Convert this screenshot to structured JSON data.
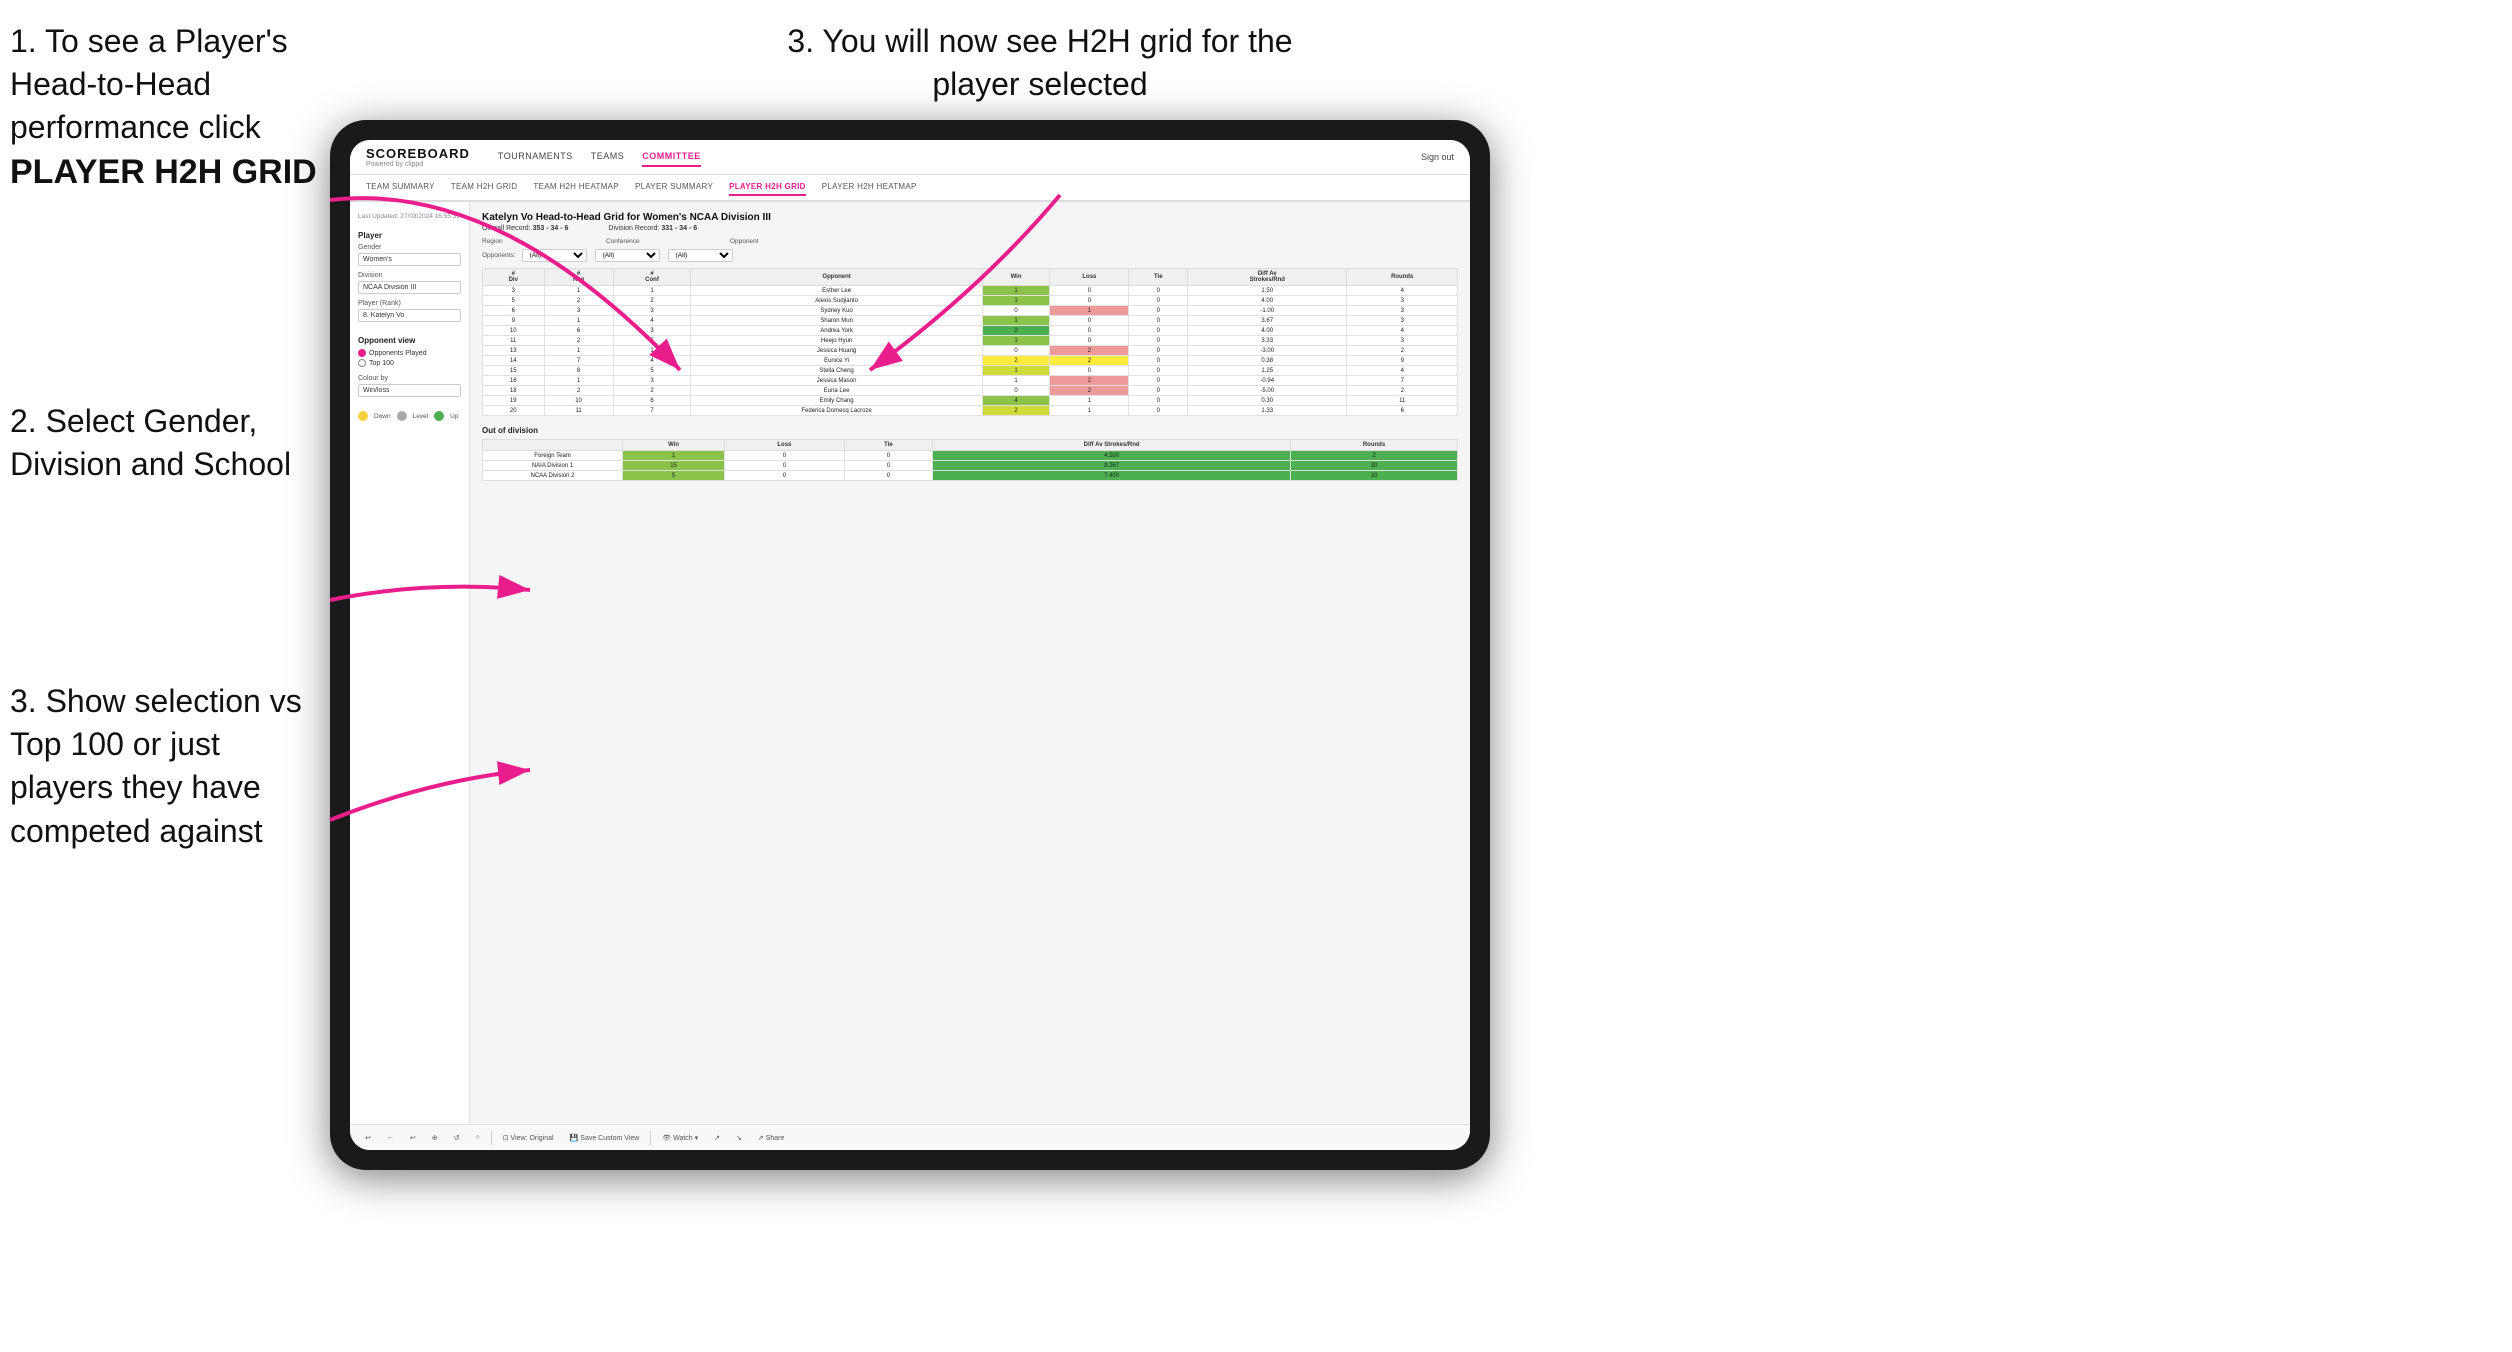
{
  "instructions": {
    "step1_title": "1. To see a Player's Head-to-Head performance click",
    "step1_bold": "PLAYER H2H GRID",
    "step2": "2. Select Gender, Division and School",
    "step3_left": "3. Show selection vs Top 100 or just players they have competed against",
    "step3_right": "3. You will now see H2H grid for the player selected"
  },
  "header": {
    "logo": "SCOREBOARD",
    "logo_sub": "Powered by clippd",
    "nav": [
      "TOURNAMENTS",
      "TEAMS",
      "COMMITTEE"
    ],
    "active_nav": "COMMITTEE",
    "sign_out": "Sign out",
    "sub_nav": [
      "TEAM SUMMARY",
      "TEAM H2H GRID",
      "TEAM H2H HEATMAP",
      "PLAYER SUMMARY",
      "PLAYER H2H GRID",
      "PLAYER H2H HEATMAP"
    ],
    "active_sub": "PLAYER H2H GRID"
  },
  "sidebar": {
    "timestamp": "Last Updated: 27/03/2024\n16:55:39",
    "player_section": "Player",
    "gender_label": "Gender",
    "gender_value": "Women's",
    "division_label": "Division",
    "division_value": "NCAA Division III",
    "player_rank_label": "Player (Rank)",
    "player_rank_value": "8. Katelyn Vo",
    "opponent_view_label": "Opponent view",
    "radio1": "Opponents Played",
    "radio2": "Top 100",
    "colour_label": "Colour by",
    "colour_value": "Win/loss",
    "legend_down": "Down",
    "legend_level": "Level",
    "legend_up": "Up"
  },
  "grid": {
    "title": "Katelyn Vo Head-to-Head Grid for Women's NCAA Division III",
    "overall_record_label": "Overall Record:",
    "overall_record": "353 - 34 - 6",
    "division_record_label": "Division Record:",
    "division_record": "331 - 34 - 6",
    "region_label": "Region",
    "conference_label": "Conference",
    "opponent_label": "Opponent",
    "opponents_label": "Opponents:",
    "opponents_filter": "(All)",
    "conference_filter": "(All)",
    "opponent_filter": "(All)",
    "col_headers": [
      "#\nDiv",
      "#\nReg",
      "#\nConf",
      "Opponent",
      "Win",
      "Loss",
      "Tie",
      "Diff Av\nStrokes/Rnd",
      "Rounds"
    ],
    "rows": [
      {
        "div": 3,
        "reg": 1,
        "conf": 1,
        "name": "Esther Lee",
        "win": 1,
        "loss": 0,
        "tie": 0,
        "diff": 1.5,
        "rounds": 4,
        "win_color": "green",
        "loss_color": ""
      },
      {
        "div": 5,
        "reg": 2,
        "conf": 2,
        "name": "Alexis Sudjianto",
        "win": 1,
        "loss": 0,
        "tie": 0,
        "diff": 4.0,
        "rounds": 3,
        "win_color": "green",
        "loss_color": ""
      },
      {
        "div": 6,
        "reg": 3,
        "conf": 3,
        "name": "Sydney Kuo",
        "win": 0,
        "loss": 1,
        "tie": 0,
        "diff": -1.0,
        "rounds": 3,
        "win_color": "",
        "loss_color": "red"
      },
      {
        "div": 9,
        "reg": 1,
        "conf": 4,
        "name": "Sharon Mun",
        "win": 1,
        "loss": 0,
        "tie": 0,
        "diff": 3.67,
        "rounds": 3,
        "win_color": "green",
        "loss_color": ""
      },
      {
        "div": 10,
        "reg": 6,
        "conf": 3,
        "name": "Andrea York",
        "win": 2,
        "loss": 0,
        "tie": 0,
        "diff": 4.0,
        "rounds": 4,
        "win_color": "green",
        "loss_color": ""
      },
      {
        "div": 11,
        "reg": 2,
        "conf": 5,
        "name": "Heejo Hyun",
        "win": 1,
        "loss": 0,
        "tie": 0,
        "diff": 3.33,
        "rounds": 3,
        "win_color": "green",
        "loss_color": ""
      },
      {
        "div": 13,
        "reg": 1,
        "conf": 1,
        "name": "Jessica Huang",
        "win": 0,
        "loss": 2,
        "tie": 0,
        "diff": -3.0,
        "rounds": 2,
        "win_color": "",
        "loss_color": "red"
      },
      {
        "div": 14,
        "reg": 7,
        "conf": 4,
        "name": "Eunice Yi",
        "win": 2,
        "loss": 2,
        "tie": 0,
        "diff": 0.38,
        "rounds": 9,
        "win_color": "yellow",
        "loss_color": "yellow"
      },
      {
        "div": 15,
        "reg": 8,
        "conf": 5,
        "name": "Stella Cheng",
        "win": 1,
        "loss": 0,
        "tie": 0,
        "diff": 1.25,
        "rounds": 4,
        "win_color": "green",
        "loss_color": ""
      },
      {
        "div": 16,
        "reg": 1,
        "conf": 3,
        "name": "Jessica Mason",
        "win": 1,
        "loss": 2,
        "tie": 0,
        "diff": -0.94,
        "rounds": 7,
        "win_color": "",
        "loss_color": "red"
      },
      {
        "div": 18,
        "reg": 2,
        "conf": 2,
        "name": "Euna Lee",
        "win": 0,
        "loss": 2,
        "tie": 0,
        "diff": -5.0,
        "rounds": 2,
        "win_color": "",
        "loss_color": "red"
      },
      {
        "div": 19,
        "reg": 10,
        "conf": 6,
        "name": "Emily Chang",
        "win": 4,
        "loss": 1,
        "tie": 0,
        "diff": 0.3,
        "rounds": 11,
        "win_color": "green",
        "loss_color": ""
      },
      {
        "div": 20,
        "reg": 11,
        "conf": 7,
        "name": "Federica Domecq Lacroze",
        "win": 2,
        "loss": 1,
        "tie": 0,
        "diff": 1.33,
        "rounds": 6,
        "win_color": "green",
        "loss_color": ""
      }
    ],
    "out_division_title": "Out of division",
    "out_division_rows": [
      {
        "name": "Foreign Team",
        "win": 1,
        "loss": 0,
        "tie": 0,
        "diff": 4.5,
        "rounds": 2
      },
      {
        "name": "NAIA Division 1",
        "win": 15,
        "loss": 0,
        "tie": 0,
        "diff": 9.267,
        "rounds": 30
      },
      {
        "name": "NCAA Division 2",
        "win": 5,
        "loss": 0,
        "tie": 0,
        "diff": 7.4,
        "rounds": 10
      }
    ]
  },
  "toolbar": {
    "buttons": [
      "↩",
      "←",
      "↩",
      "⊕",
      "↺",
      "○",
      "⊡",
      "View: Original",
      "Save Custom View",
      "Watch ▾",
      "↗",
      "↘",
      "Share"
    ]
  }
}
